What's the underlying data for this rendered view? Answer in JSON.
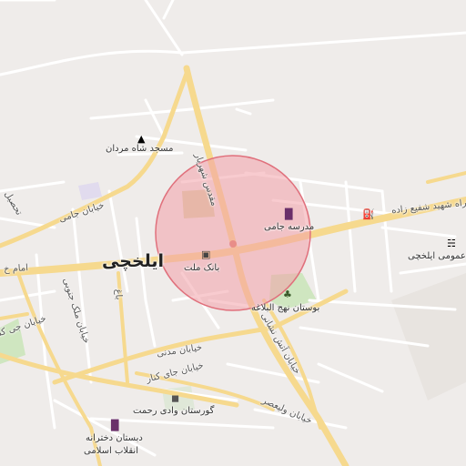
{
  "map": {
    "city_label": "ایلخچی",
    "streets": {
      "shahid_shafi_zadeh": "راه شهید شفیع زاده",
      "moghadas_shahriar": "مقدس شهریار",
      "jami_west": "خیابان جامی",
      "imam": "امام خ",
      "tahsil": "تحصیل",
      "bagh": "باغ",
      "salehi_jenubi": "خیابان ملک جنوبی",
      "mellat_kenar": "خیابان جی کنار",
      "madani": "خیابان مدنی",
      "jay_kenar": "خیابان جای کنار",
      "atash_neshani": "خیابان آتش نشانی",
      "valiasr": "خیابان ولیعصر",
      "kenar": "خیابان جی کنار"
    },
    "pois": {
      "mosque": "مسجد شاه مردان",
      "jami_school": "مدرسه جامی",
      "bank_mellat": "بانک ملت",
      "nahj_park": "بوستان نهج البلاغه",
      "public_library": "عمومی ایلخچی",
      "cemetery": "گورستان وادی رحمت",
      "girls_school_line1": "دبستان دخترانه",
      "girls_school_line2": "انقلاب اسلامی"
    },
    "icons": {
      "mosque": "mosque-icon",
      "school": "school-icon",
      "bank": "bank-icon",
      "park": "park-icon",
      "library": "library-icon",
      "cemetery": "cemetery-icon",
      "fuel": "fuel-icon"
    },
    "colors": {
      "background": "#efecea",
      "major_road": "#f8d88a",
      "minor_road": "#ffffff",
      "highlight_circle_fill": "#f3a0a8",
      "highlight_circle_stroke": "#e0707c",
      "park_green": "#cfe6c0",
      "sports_field": "#d9d2a8"
    }
  }
}
